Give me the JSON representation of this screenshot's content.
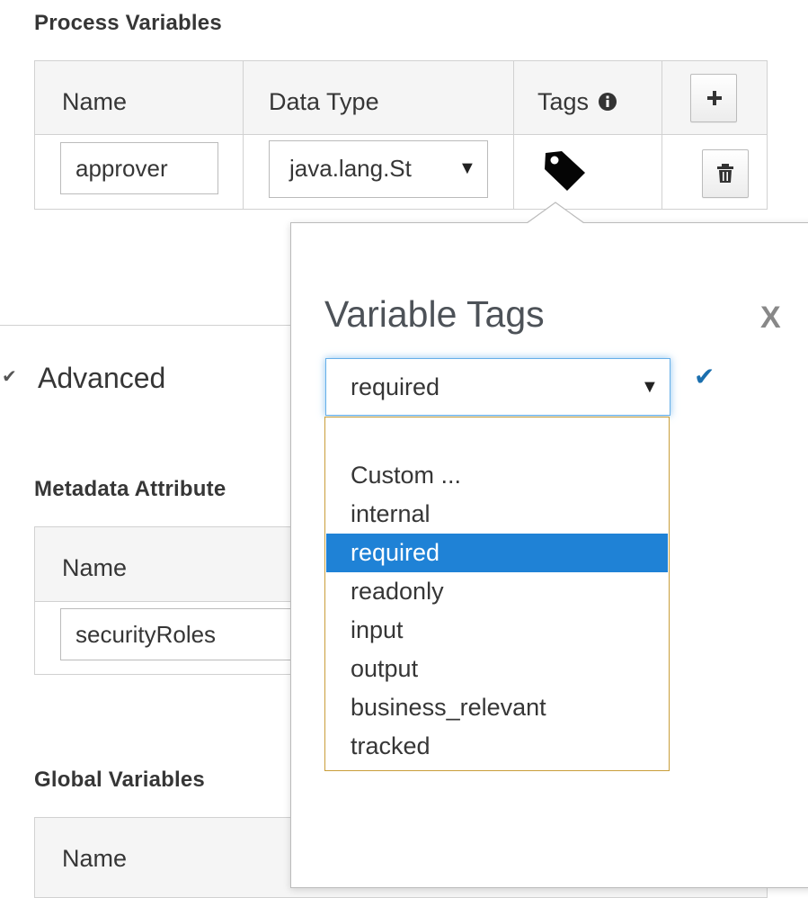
{
  "process_variables": {
    "title": "Process Variables",
    "columns": [
      "Name",
      "Data Type",
      "Tags"
    ],
    "rows": [
      {
        "name": "approver",
        "data_type": "java.lang.St"
      }
    ]
  },
  "advanced": {
    "label": "Advanced",
    "toggle_glyph": "✔"
  },
  "metadata_attributes": {
    "title": "Metadata Attribute",
    "column_name": "Name",
    "rows": [
      {
        "name": "securityRoles"
      }
    ]
  },
  "global_variables": {
    "title": "Global Variables",
    "column_name": "Name"
  },
  "tags_popover": {
    "title": "Variable Tags",
    "close_label": "X",
    "confirm_glyph": "✔",
    "selected_tag": "required",
    "options": [
      "",
      "Custom ...",
      "internal",
      "required",
      "readonly",
      "input",
      "output",
      "business_relevant",
      "tracked"
    ],
    "selected_index": 3
  },
  "icons": {
    "info": "info-circle-icon",
    "tag": "tag-icon",
    "add": "plus-icon",
    "delete": "trash-icon",
    "caret": "caret-down-icon"
  },
  "colors": {
    "accent": "#1f82d6",
    "focus": "#66afe9",
    "confirm": "#1b6fae"
  }
}
